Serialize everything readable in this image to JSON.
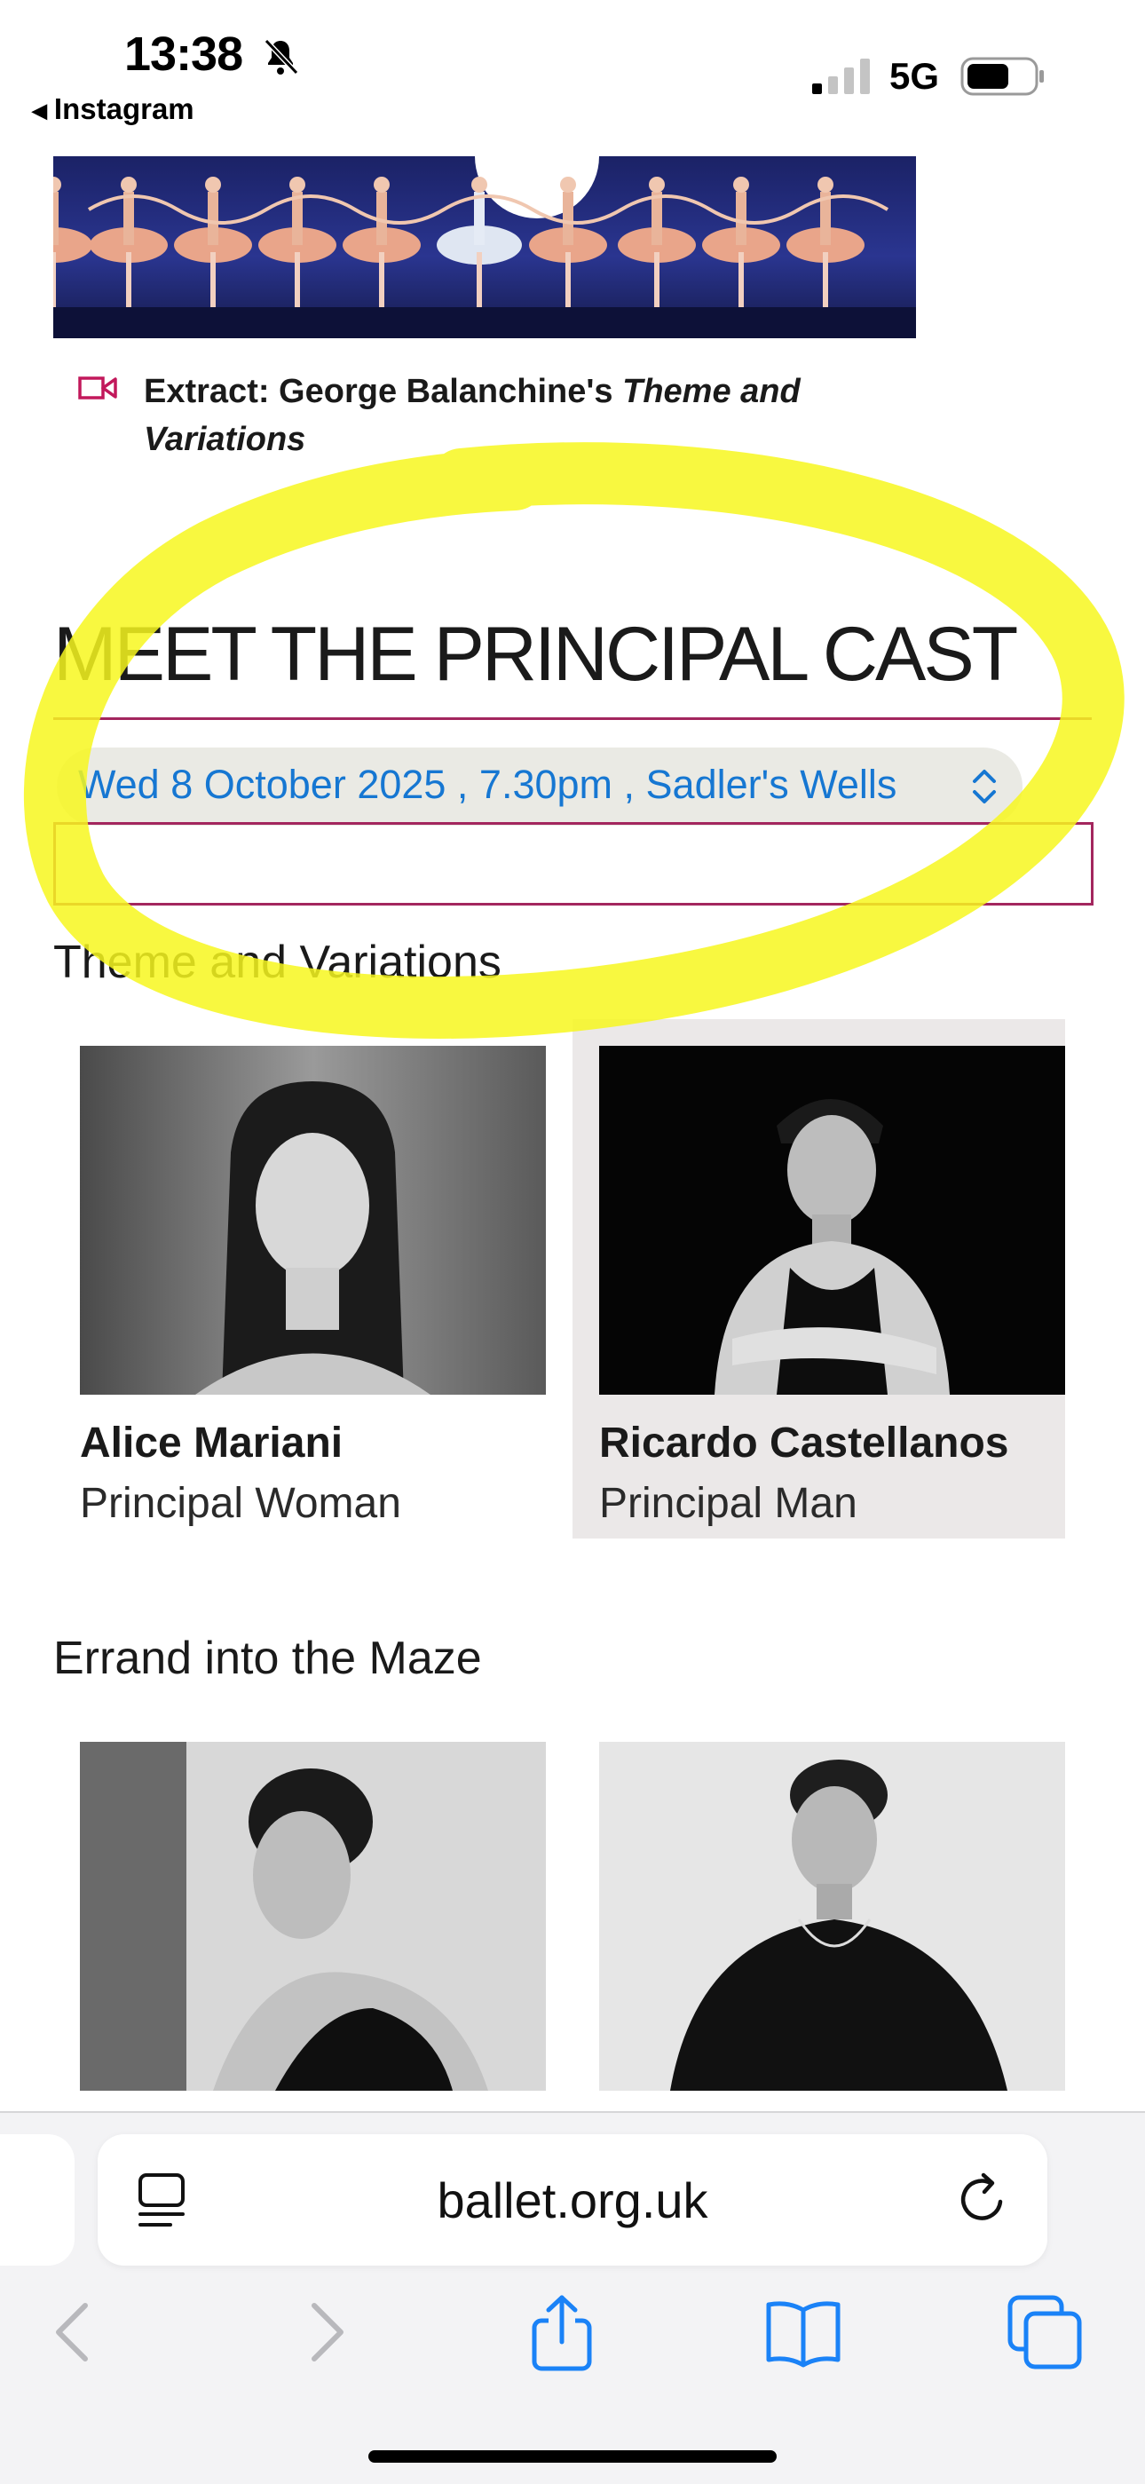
{
  "status_bar": {
    "time": "13:38",
    "back_app": "Instagram",
    "network": "5G"
  },
  "extract": {
    "prefix": "Extract: George Balanchine's ",
    "italic": "Theme and Variations"
  },
  "cast_section": {
    "heading": "MEET THE PRINCIPAL CAST",
    "date_select": "Wed 8 October 2025 , 7.30pm , Sadler's Wells",
    "works": [
      {
        "title": "Theme and Variations",
        "cast": [
          {
            "name": "Alice Mariani",
            "role": "Principal Woman"
          },
          {
            "name": "Ricardo Castellanos",
            "role": "Principal Man"
          }
        ]
      },
      {
        "title": "Errand into the Maze"
      }
    ]
  },
  "browser": {
    "url": "ballet.org.uk"
  },
  "colors": {
    "accent": "#a3265e",
    "link": "#1677d2",
    "highlighter": "#f7f71e",
    "ios_blue": "#1a82f7"
  }
}
